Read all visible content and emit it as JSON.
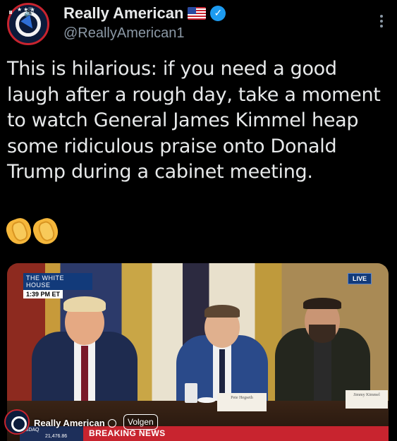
{
  "post": {
    "author_name": "Really American",
    "handle": "@ReallyAmerican1",
    "text": "This is hilarious: if you need a good\nlaugh after a rough day, take a moment\nto watch General James Kimmel heap\nsome ridiculous praise onto Donald\nTrump during a cabinet meeting.",
    "emojis": [
      "clapping-hands",
      "clapping-hands"
    ],
    "flag_icon": "us-flag-icon",
    "verified_color": "#1d9bf0"
  },
  "video": {
    "tag_title": "THE WHITE HOUSE",
    "tag_time": "1:39 PM ET",
    "live_label": "LIVE",
    "nameplate_left": "Pete Hegseth",
    "nameplate_right": "Jimmy Kimmel",
    "overlay_author": "Really American",
    "follow_label": "Volgen",
    "ticker_label": "ASDAQ",
    "ticker_value": "21,476.86",
    "breaking_label": "BREAKING NEWS"
  },
  "colors": {
    "background": "#000000",
    "text": "#e7e9ea",
    "secondary_text": "#8b98a5",
    "breaking_red": "#c8242f",
    "network_blue": "#123a7a"
  }
}
